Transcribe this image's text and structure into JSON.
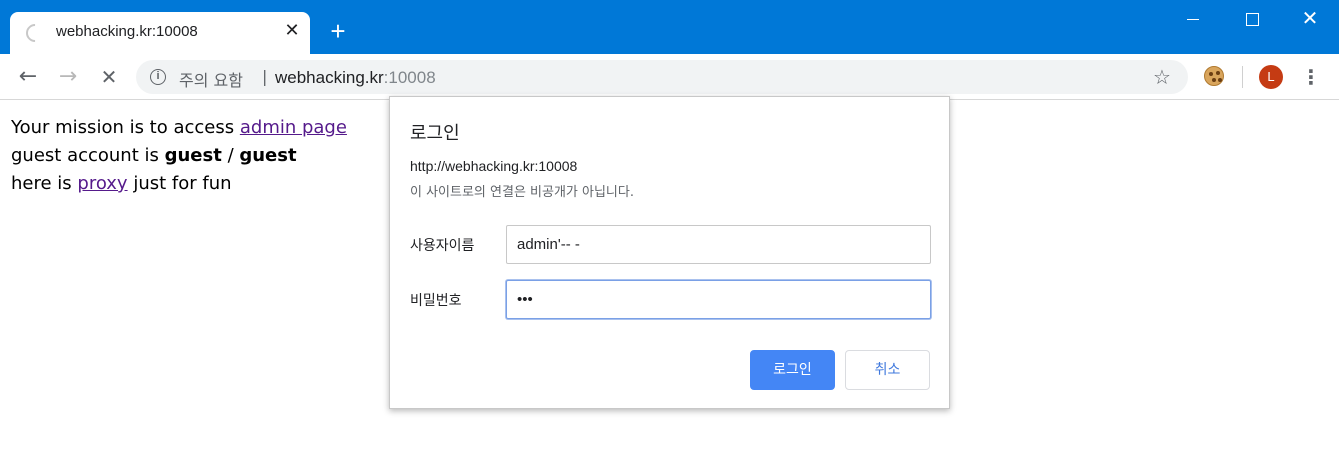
{
  "browser": {
    "tab": {
      "title": "webhacking.kr:10008",
      "close_glyph": "✕"
    },
    "new_tab_glyph": "+",
    "window_controls": {
      "close_glyph": "✕"
    },
    "nav": {
      "back_glyph": "←",
      "forward_glyph": "→",
      "stop_glyph": "✕"
    },
    "omnibox": {
      "security_label": "주의 요함",
      "separator": "|",
      "host": "webhacking.kr",
      "port": ":10008"
    },
    "icons": {
      "star": "star-icon",
      "cookie": "cookie-icon",
      "menu": "kebab-menu-icon"
    },
    "avatar_letter": "L",
    "menu_glyph": "⋮",
    "star_glyph": "☆",
    "colors": {
      "titlebar": "#0078d7",
      "avatar": "#c53b13",
      "primary_button": "#4486f5",
      "visited_link": "#551a8b"
    }
  },
  "page": {
    "line1_prefix": "Your mission is to access ",
    "admin_link": "admin page",
    "line2_prefix": "guest account is ",
    "guest_user": "guest",
    "line2_sep": " / ",
    "guest_pass": "guest",
    "line3_prefix": "here is ",
    "proxy_link": "proxy",
    "line3_suffix": " just for fun"
  },
  "dialog": {
    "title": "로그인",
    "url": "http://webhacking.kr:10008",
    "warning": "이 사이트로의 연결은 비공개가 아닙니다.",
    "username_label": "사용자이름",
    "username_value": "admin'-- -",
    "password_label": "비밀번호",
    "password_value": "•••",
    "login_button": "로그인",
    "cancel_button": "취소"
  }
}
